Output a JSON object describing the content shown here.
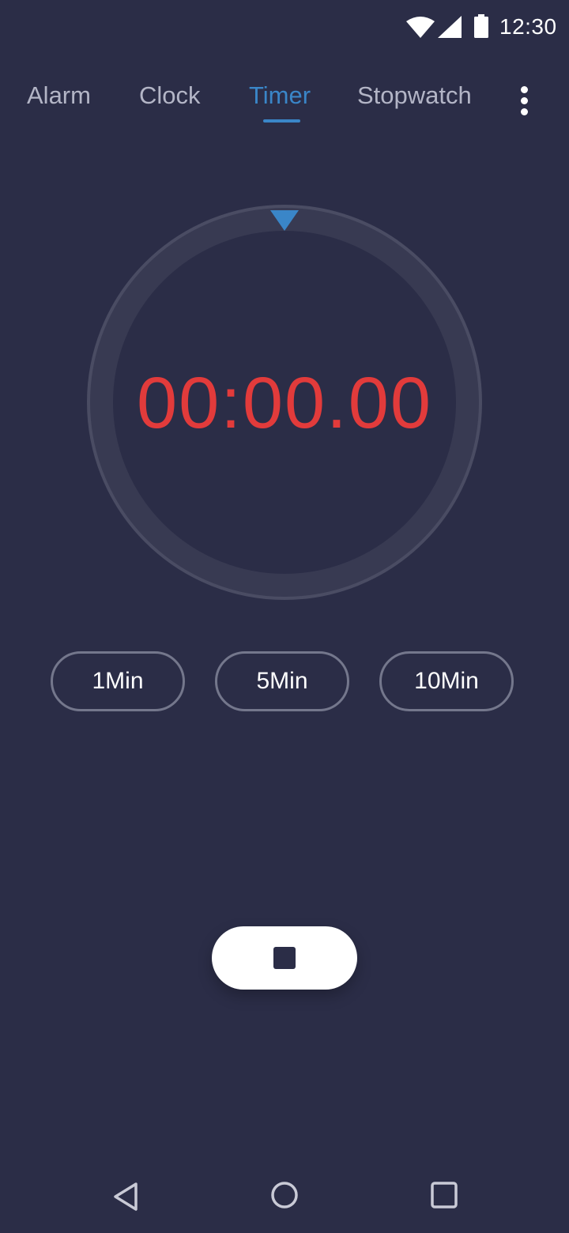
{
  "status_bar": {
    "time": "12:30",
    "icons": [
      "wifi-icon",
      "signal-icon",
      "battery-icon"
    ]
  },
  "tabs": [
    {
      "label": "Alarm",
      "active": false
    },
    {
      "label": "Clock",
      "active": false
    },
    {
      "label": "Timer",
      "active": true
    },
    {
      "label": "Stopwatch",
      "active": false
    }
  ],
  "timer": {
    "display": "00:00.00"
  },
  "presets": [
    {
      "label": "1Min"
    },
    {
      "label": "5Min"
    },
    {
      "label": "10Min"
    }
  ],
  "controls": {
    "stop_icon": "stop-icon"
  },
  "navigation": {
    "icons": [
      "back-icon",
      "home-icon",
      "recents-icon"
    ]
  },
  "colors": {
    "background": "#2b2d47",
    "accent": "#3a86c8",
    "timer_text": "#e23b3b",
    "tab_inactive": "#b3b5c6",
    "pill_border": "#74778c"
  }
}
